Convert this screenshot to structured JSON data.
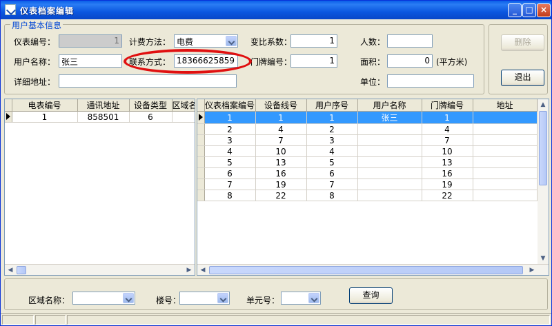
{
  "window": {
    "title": "仪表档案编辑"
  },
  "group_basic": {
    "label": "用户基本信息"
  },
  "form": {
    "meter_no_label": "仪表编号：",
    "meter_no_value": "1",
    "billing_label": "计费方法：",
    "billing_value": "电费",
    "ratio_label": "变比系数：",
    "ratio_value": "1",
    "people_label": "人数：",
    "people_value": "",
    "username_label": "用户名称：",
    "username_value": "张三",
    "contact_label": "联系方式：",
    "contact_value": "18366625859",
    "doorplate_label": "门牌编号：",
    "doorplate_value": "1",
    "area_label": "面积：",
    "area_value": "0",
    "area_unit": "(平方米)",
    "address_label": "详细地址：",
    "address_value": "",
    "unit_label": "单位：",
    "unit_value": ""
  },
  "buttons": {
    "delete": "删除",
    "exit": "退出",
    "query": "查询"
  },
  "left_grid": {
    "columns": [
      "电表编号",
      "通讯地址",
      "设备类型",
      "区域名称"
    ],
    "rows": [
      [
        "1",
        "858501",
        "6",
        ""
      ]
    ]
  },
  "right_grid": {
    "columns": [
      "仪表档案编号",
      "设备线号",
      "用户序号",
      "用户名称",
      "门牌编号",
      "地址"
    ],
    "rows": [
      [
        "1",
        "1",
        "1",
        "张三",
        "1",
        ""
      ],
      [
        "2",
        "4",
        "2",
        "",
        "4",
        ""
      ],
      [
        "3",
        "7",
        "3",
        "",
        "7",
        ""
      ],
      [
        "4",
        "10",
        "4",
        "",
        "10",
        ""
      ],
      [
        "5",
        "13",
        "5",
        "",
        "13",
        ""
      ],
      [
        "6",
        "16",
        "6",
        "",
        "16",
        ""
      ],
      [
        "7",
        "19",
        "7",
        "",
        "19",
        ""
      ],
      [
        "8",
        "22",
        "8",
        "",
        "22",
        ""
      ]
    ]
  },
  "filter": {
    "region_label": "区域名称：",
    "region_value": "",
    "building_label": "楼号：",
    "building_value": "",
    "unitno_label": "单元号：",
    "unitno_value": ""
  },
  "colors": {
    "highlight_circle": "#e01010",
    "selection": "#3399ff",
    "titlebar": "#0a5fe8"
  }
}
